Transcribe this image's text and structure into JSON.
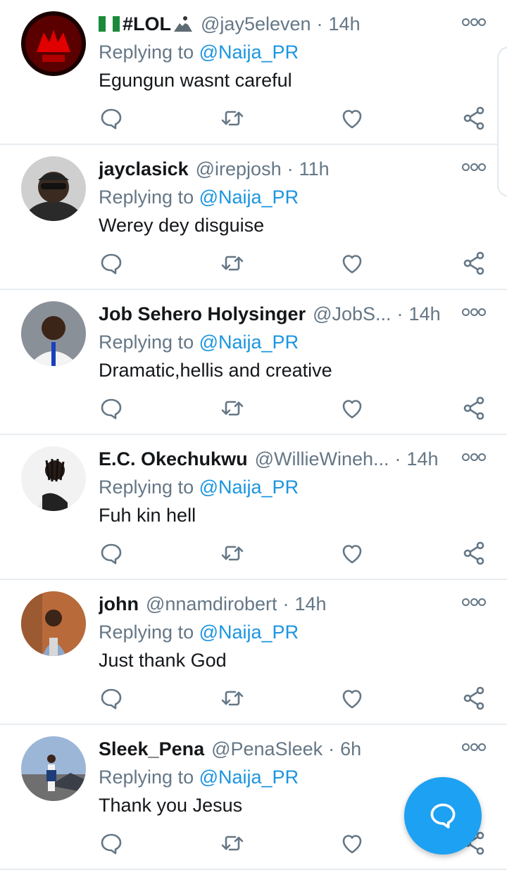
{
  "colors": {
    "accent": "#1da1f2",
    "link": "#1b95e0",
    "muted": "#657786",
    "divider": "#e6ecf0"
  },
  "replying_prefix": "Replying to",
  "icons": {
    "reply": "reply-icon",
    "retweet": "retweet-icon",
    "like": "heart-icon",
    "share": "share-icon",
    "more": "more-icon",
    "compose": "compose-reply-icon"
  },
  "tweets": [
    {
      "name": "#LOL",
      "handle": "@jay5eleven",
      "time": "14h",
      "replying_to": "@Naija_PR",
      "text": "Egungun wasnt careful"
    },
    {
      "name": "jayclasick",
      "handle": "@irepjosh",
      "time": "11h",
      "replying_to": "@Naija_PR",
      "text": "Werey dey disguise"
    },
    {
      "name": "Job Sehero Holysinger",
      "handle": "@JobS...",
      "time": "14h",
      "replying_to": "@Naija_PR",
      "text": "Dramatic,hellis and creative"
    },
    {
      "name": "E.C. Okechukwu",
      "handle": "@WillieWineh...",
      "time": "14h",
      "replying_to": "@Naija_PR",
      "text": "Fuh kin hell"
    },
    {
      "name": "john",
      "handle": "@nnamdirobert",
      "time": "14h",
      "replying_to": "@Naija_PR",
      "text": "Just thank God"
    },
    {
      "name": "Sleek_Pena",
      "handle": "@PenaSleek",
      "time": "6h",
      "replying_to": "@Naija_PR",
      "text": "Thank you Jesus"
    }
  ]
}
